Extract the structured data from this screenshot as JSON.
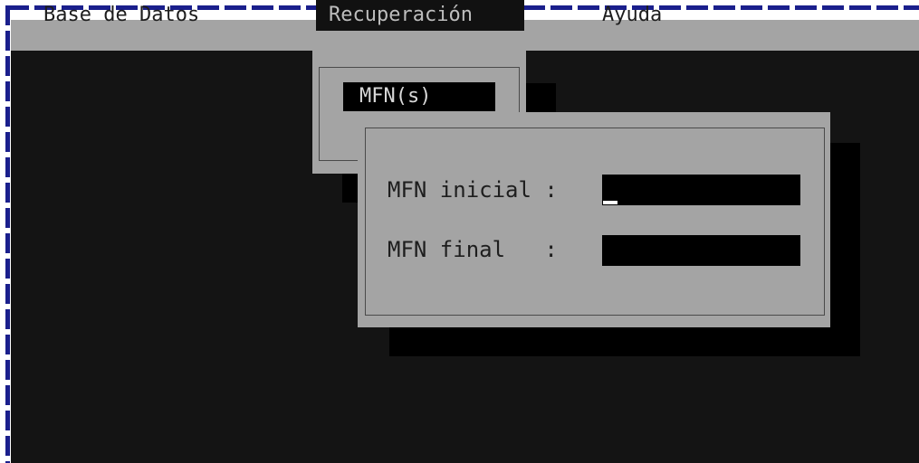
{
  "menubar": {
    "items": [
      {
        "label": "Base de Datos",
        "active": false
      },
      {
        "label": "Recuperación",
        "active": true
      },
      {
        "label": "Ayuda",
        "active": false
      }
    ]
  },
  "recuperacion_menu": {
    "items": [
      {
        "label": "MFN(s)"
      }
    ]
  },
  "mfn_dialog": {
    "fields": [
      {
        "label": "MFN inicial :",
        "value": ""
      },
      {
        "label": "MFN final   :",
        "value": ""
      }
    ]
  },
  "colors": {
    "background": "#141414",
    "panel": "#a4a4a4",
    "text": "#1e1e1e",
    "border_dash": "#1a1f8c"
  }
}
